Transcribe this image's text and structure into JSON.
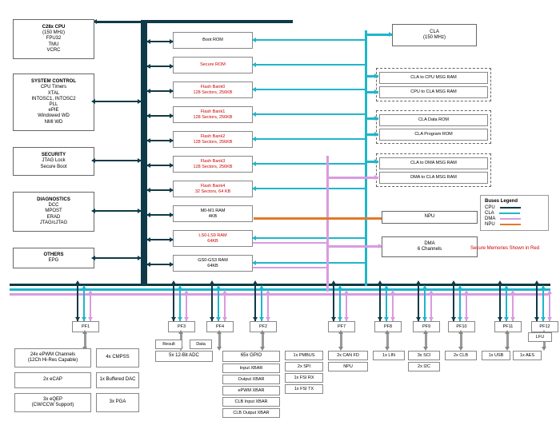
{
  "left_blocks": {
    "cpu": {
      "title": "C28x CPU",
      "lines": [
        "(150 MHz)",
        "FPU32",
        "TMU",
        "VCRC"
      ]
    },
    "sysctrl": {
      "title": "SYSTEM CONTROL",
      "lines": [
        "CPU Timers",
        "XTAL",
        "INTOSC1, INTOSC2",
        "PLL",
        "ePIE",
        "Windowed WD",
        "NMI WD"
      ]
    },
    "security": {
      "title": "SECURITY",
      "lines": [
        "JTAG Lock",
        "Secure Boot"
      ]
    },
    "diag": {
      "title": "DIAGNOSTICS",
      "lines": [
        "DCC",
        "MPOST",
        "ERAD",
        "JTAG/cJTAG"
      ]
    },
    "others": {
      "title": "OTHERS",
      "lines": [
        "EPG"
      ]
    }
  },
  "mem_blocks": [
    {
      "id": "bootrom",
      "label": "Boot ROM",
      "secure": false
    },
    {
      "id": "securerom",
      "label": "Secure ROM",
      "secure": true
    },
    {
      "id": "flash0",
      "label": "Flash Bank0\n128 Sectors, 256KB",
      "secure": true
    },
    {
      "id": "flash1",
      "label": "Flash Bank1\n128 Sectors, 256KB",
      "secure": true
    },
    {
      "id": "flash2",
      "label": "Flash Bank2\n128 Sectors, 256KB",
      "secure": true
    },
    {
      "id": "flash3",
      "label": "Flash Bank3\n128 Sectors, 256KB",
      "secure": true
    },
    {
      "id": "flash4",
      "label": "Flash Bank4\n32 Sectors, 64 KB",
      "secure": true
    },
    {
      "id": "m0m1",
      "label": "M0-M1 RAM\n4KB",
      "secure": false
    },
    {
      "id": "ls0ls9",
      "label": "LS0-LS9 RAM\n64KB",
      "secure": true
    },
    {
      "id": "gs0gs3",
      "label": "GS0-GS3 RAM\n64KB",
      "secure": false
    }
  ],
  "right_blocks": {
    "cla": {
      "label": "CLA\n(150 MHz)"
    },
    "cla2cpu": {
      "label": "CLA to CPU MSG RAM"
    },
    "cpu2cla": {
      "label": "CPU to CLA MSG RAM"
    },
    "cladatarom": {
      "label": "CLA Data ROM"
    },
    "claprogrom": {
      "label": "CLA Program ROM"
    },
    "cla2dma": {
      "label": "CLA to DMA MSG RAM"
    },
    "dma2cla": {
      "label": "DMA to CLA MSG RAM"
    },
    "npu": {
      "label": "NPU"
    },
    "dma": {
      "label": "DMA\n6 Channels"
    }
  },
  "pf_labels": [
    "PF1",
    "PF3",
    "PF4",
    "PF2",
    "PF7",
    "PF8",
    "PF9",
    "PF10",
    "PF11",
    "PF12"
  ],
  "periph_left": {
    "epwm": "24x ePWM Channels\n(12Ch Hi-Res Capable)",
    "cmpss": "4x CMPSS",
    "ecap": "2x eCAP",
    "dac": "1x Buffered DAC",
    "eqep": "3x eQEP\n(CW/CCW Support)",
    "pga": "3x PGA"
  },
  "periph_mid": {
    "result": "Result",
    "data": "Data",
    "adc": "5x 12-Bit ADC",
    "gpio": "65x GPIO",
    "xbar": [
      "Input XBAR",
      "Output XBAR",
      "ePWM XBAR",
      "CLB Input XBAR",
      "CLB Output XBAR"
    ]
  },
  "periph_right": {
    "pmbus": "1x PMBUS",
    "spi": "2x SPI",
    "fsirx": "1x FSI RX",
    "fsitx": "1x FSI TX",
    "canfd": "2x CAN FD",
    "npu": "NPU",
    "lin": "1x LIN",
    "sci": "3x SCI",
    "i2c": "2x I2C",
    "clb": "2x CLB",
    "usb": "1x USB",
    "aes": "1x AES",
    "lfu": "LFU"
  },
  "legend": {
    "title": "Buses Legend",
    "rows": [
      {
        "name": "CPU",
        "color": "#0f3a47"
      },
      {
        "name": "CLA",
        "color": "#20b6c9"
      },
      {
        "name": "DMA",
        "color": "#d99be0"
      },
      {
        "name": "NPU",
        "color": "#e07a2a"
      }
    ],
    "secure_note": "Secure Memories Shown in Red"
  }
}
